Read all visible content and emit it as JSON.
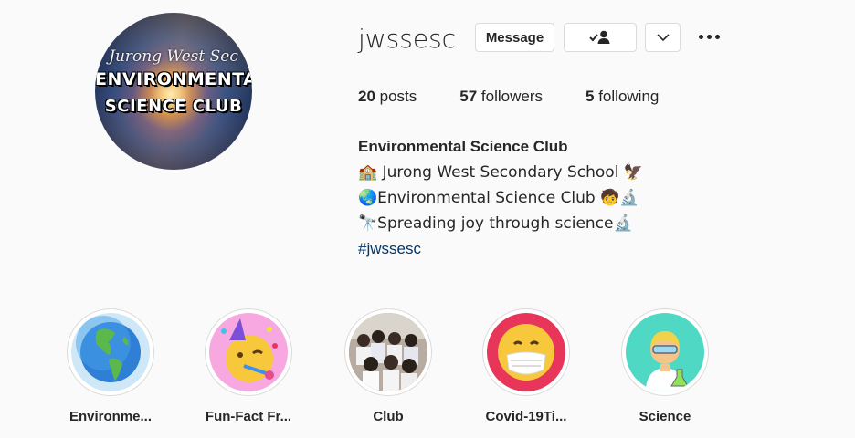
{
  "profile": {
    "avatar_text_top": "Jurong West Sec",
    "avatar_text_line1": "ENVIRONMENTAL",
    "avatar_text_line2": "SCIENCE CLUB",
    "username": "jwssesc",
    "message_label": "Message",
    "follow_icon": "person-check-icon",
    "dropdown_icon": "chevron-down-icon",
    "more_icon": "more-options-icon"
  },
  "stats": {
    "posts_count": "20",
    "posts_label": " posts",
    "followers_count": "57",
    "followers_label": " followers",
    "following_count": "5",
    "following_label": " following"
  },
  "bio": {
    "name": "Environmental Science Club",
    "line1": "🏫 Jurong West Secondary School 🦅",
    "line2": "🌏Environmental Science Club 🧒🔬",
    "line3": "🔭Spreading joy through science🔬",
    "hashtag": "#jwssesc"
  },
  "highlights": [
    {
      "label": "Environme...",
      "icon": "globe-americas-icon",
      "bg": "#cfe8f7"
    },
    {
      "label": "Fun-Fact Fr...",
      "icon": "partying-face-icon",
      "bg": "#f7a8e0"
    },
    {
      "label": "Club",
      "icon": "group-photo-icon",
      "bg": "#8a7f7a"
    },
    {
      "label": "Covid-19Ti...",
      "icon": "face-with-mask-icon",
      "bg": "#e8365a"
    },
    {
      "label": "Science",
      "icon": "scientist-icon",
      "bg": "#4fd8c4"
    }
  ],
  "colors": {
    "background": "#fafafa",
    "text": "#262626",
    "link": "#00376b",
    "border": "#dbdbdb"
  }
}
